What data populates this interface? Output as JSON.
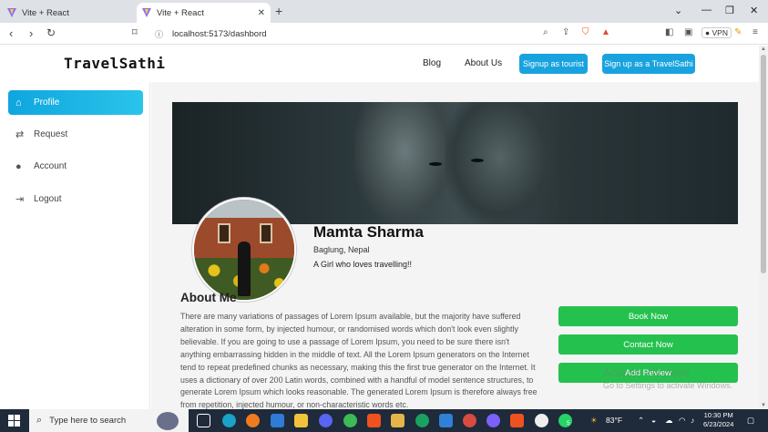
{
  "browser": {
    "tabs": [
      {
        "title": "Vite + React",
        "active": false
      },
      {
        "title": "Vite + React",
        "active": true
      }
    ],
    "url": "localhost:5173/dashbord",
    "vpn_label": "VPN"
  },
  "header": {
    "logo": "TravelSathi",
    "nav": [
      {
        "label": "Blog"
      },
      {
        "label": "About Us"
      }
    ],
    "signup_tourist": "Signup as tourist",
    "signup_sathi": "Sign up as a TravelSathi"
  },
  "sidebar": {
    "items": [
      {
        "label": "Profile",
        "icon": "home-icon",
        "active": true
      },
      {
        "label": "Request",
        "icon": "swap-icon",
        "active": false
      },
      {
        "label": "Account",
        "icon": "user-icon",
        "active": false
      },
      {
        "label": "Logout",
        "icon": "logout-icon",
        "active": false
      }
    ]
  },
  "profile": {
    "name": "Mamta Sharma",
    "location": "Baglung, Nepal",
    "bio": "A Girl who loves travelling!!"
  },
  "about": {
    "title": "About Me",
    "text": "There are many variations of passages of Lorem Ipsum available, but the majority have suffered alteration in some form, by injected humour, or randomised words which don't look even slightly believable. If you are going to use a passage of Lorem Ipsum, you need to be sure there isn't anything embarrassing hidden in the middle of text. All the Lorem Ipsum generators on the Internet tend to repeat predefined chunks as necessary, making this the first true generator on the Internet. It uses a dictionary of over 200 Latin words, combined with a handful of model sentence structures, to generate Lorem Ipsum which looks reasonable. The generated Lorem Ipsum is therefore always free from repetition, injected humour, or non-characteristic words etc."
  },
  "actions": {
    "book_now": "Book Now",
    "contact_now": "Contact Now",
    "add_review": "Add Review"
  },
  "watermark": {
    "line1": "Activate Windows",
    "line2": "Go to Settings to activate Windows."
  },
  "taskbar": {
    "search_placeholder": "Type here to search",
    "weather": "83°F",
    "time": "10:30 PM",
    "date": "6/23/2024",
    "badge": "5"
  },
  "colors": {
    "accent_cyan": "#18a3de",
    "action_green": "#25c14f",
    "taskbar": "#1f2a3a"
  }
}
